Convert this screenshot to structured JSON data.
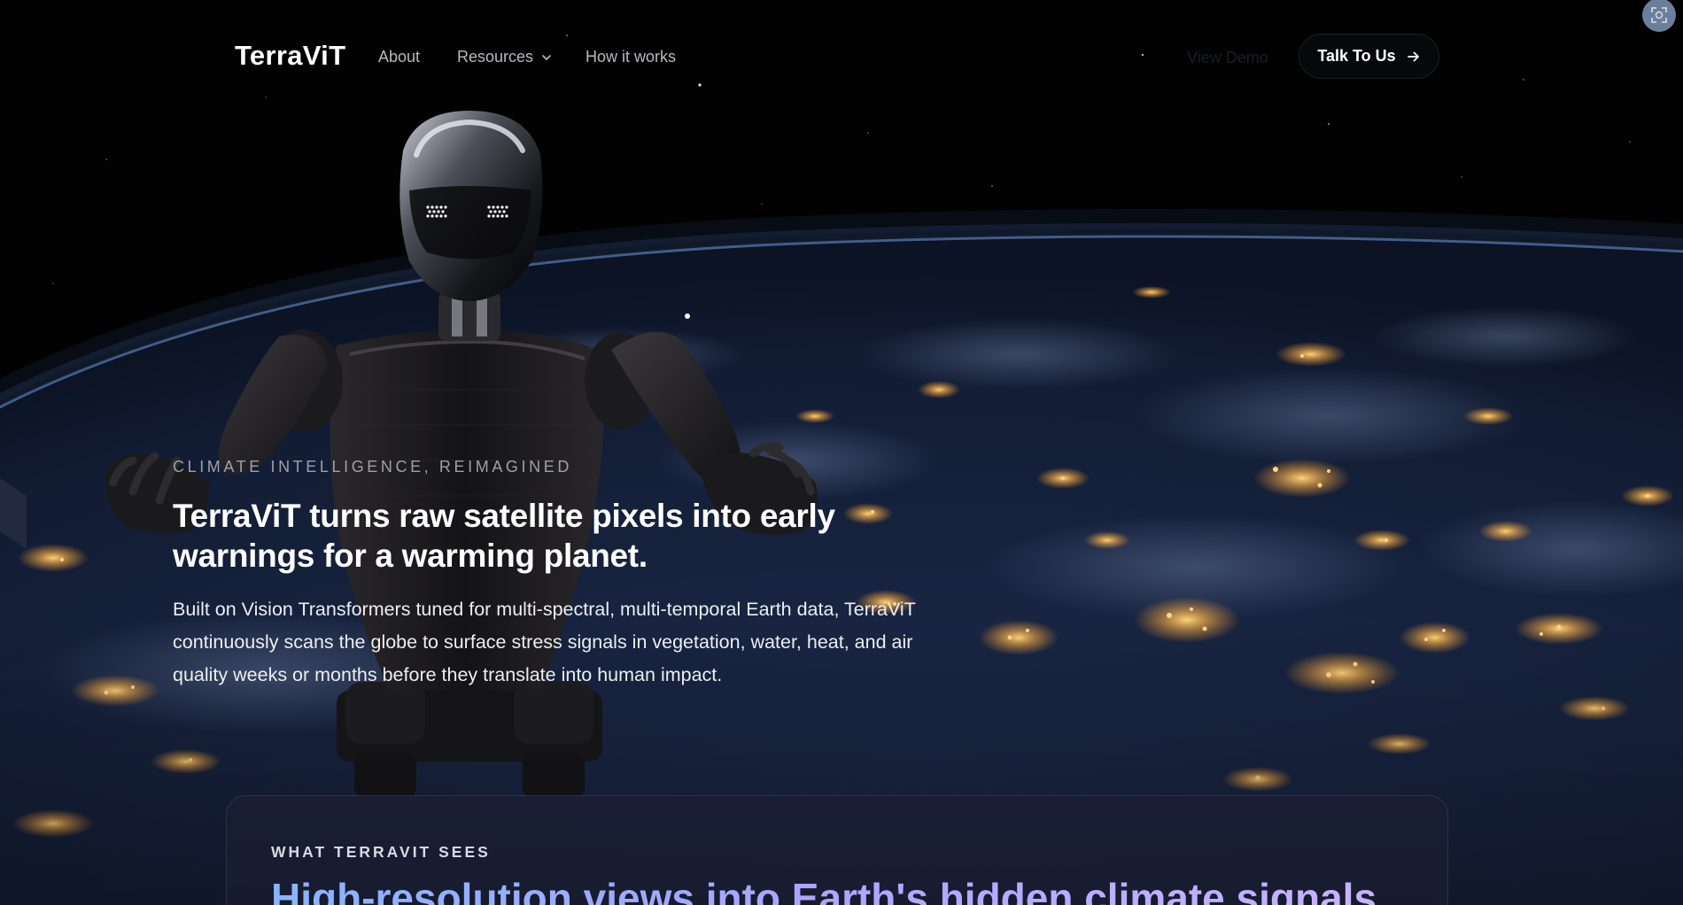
{
  "nav": {
    "brand": "TerraViT",
    "links": {
      "about": "About",
      "resources": "Resources",
      "how_it_works": "How it works"
    },
    "view_demo": "View Demo",
    "talk_button": "Talk To Us",
    "icons": {
      "resources_caret": "chevron-down-icon",
      "talk_arrow": "arrow-right-icon",
      "corner": "screen-capture-icon"
    }
  },
  "hero": {
    "kicker": "Climate Intelligence, Reimagined",
    "title": "TerraViT turns raw satellite pixels into early warnings for a warming planet.",
    "body": "Built on Vision Transformers tuned for multi-spectral, multi-temporal Earth data, TerraViT continuously scans the globe to surface stress signals in vegetation, water, heat, and air quality weeks or months before they translate into human impact."
  },
  "card": {
    "kicker": "WHAT TERRAVIT SEES",
    "title": "High-resolution views into Earth's hidden climate signals."
  },
  "colors": {
    "background": "#000000",
    "button_bg": "#07080b",
    "card_bg": "#1a1f34",
    "gradient_start": "#8ab4ff",
    "gradient_end": "#c9b3ff",
    "city_lights": "#ffc46b"
  }
}
